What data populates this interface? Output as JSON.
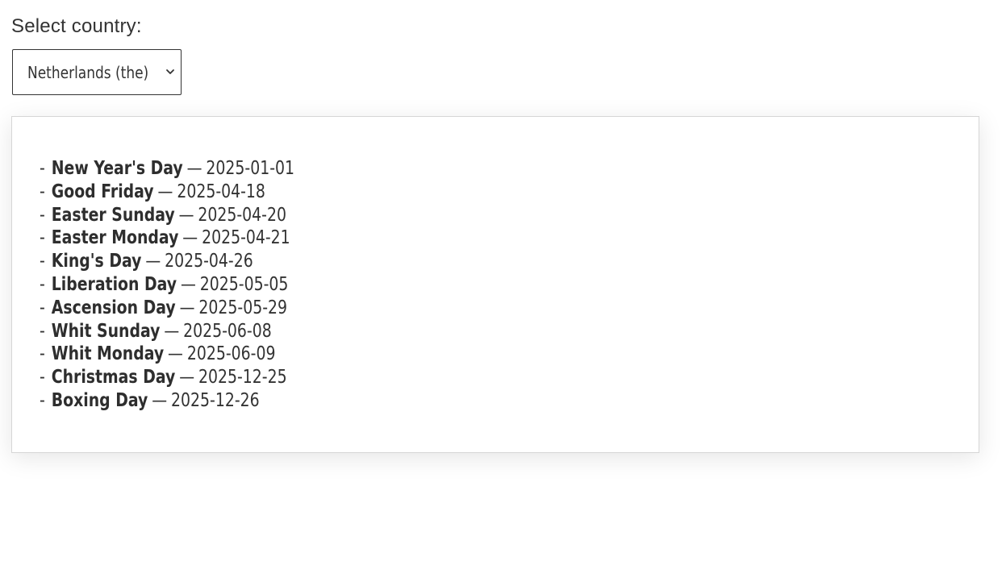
{
  "form": {
    "label": "Select country:",
    "selected_country": "Netherlands (the)"
  },
  "holidays": [
    {
      "name": "New Year's Day",
      "date": "2025-01-01"
    },
    {
      "name": "Good Friday",
      "date": "2025-04-18"
    },
    {
      "name": "Easter Sunday",
      "date": "2025-04-20"
    },
    {
      "name": "Easter Monday",
      "date": "2025-04-21"
    },
    {
      "name": "King's Day",
      "date": "2025-04-26"
    },
    {
      "name": "Liberation Day",
      "date": "2025-05-05"
    },
    {
      "name": "Ascension Day",
      "date": "2025-05-29"
    },
    {
      "name": "Whit Sunday",
      "date": "2025-06-08"
    },
    {
      "name": "Whit Monday",
      "date": "2025-06-09"
    },
    {
      "name": "Christmas Day",
      "date": "2025-12-25"
    },
    {
      "name": "Boxing Day",
      "date": "2025-12-26"
    }
  ],
  "list_format": {
    "bullet": "-",
    "separator": "—"
  },
  "icons": {
    "dropdown": "chevron-down-icon"
  }
}
